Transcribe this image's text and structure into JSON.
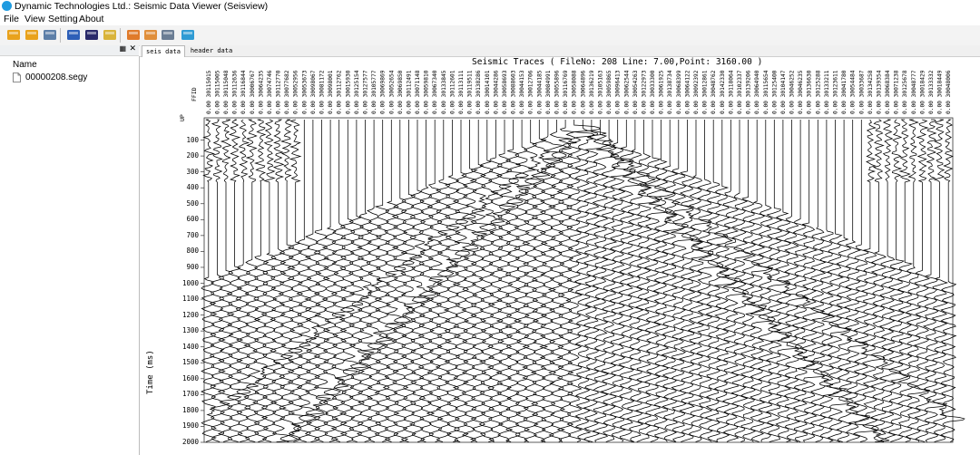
{
  "window": {
    "title": "Dynamic Technologies Ltd.: Seismic Data Viewer (Seisview)"
  },
  "menu": [
    {
      "label": "File",
      "x": 4
    },
    {
      "label": "View",
      "x": 27
    },
    {
      "label": "Setting",
      "x": 53
    },
    {
      "label": "About",
      "x": 87
    }
  ],
  "toolbar": {
    "buttons": [
      {
        "name": "open-folder-icon",
        "color": "#e9a21c",
        "x": 6
      },
      {
        "name": "open-folder-alt-icon",
        "color": "#e9a21c",
        "x": 26
      },
      {
        "name": "pencil-icon",
        "color": "#5d7fa8",
        "x": 46
      },
      {
        "name": "chart-icon",
        "color": "#2d5fb8",
        "x": 72
      },
      {
        "name": "wiggle-icon",
        "color": "#2a2a6a",
        "x": 92
      },
      {
        "name": "save-disk-icon",
        "color": "#d9b43a",
        "x": 112
      },
      {
        "name": "export-icon",
        "color": "#e07a2a",
        "x": 138
      },
      {
        "name": "copy-icon",
        "color": "#e08f3c",
        "x": 157
      },
      {
        "name": "print-icon",
        "color": "#6a7d94",
        "x": 176
      },
      {
        "name": "import-icon",
        "color": "#2f9bd4",
        "x": 198
      }
    ]
  },
  "tree": {
    "column_header": "Name",
    "files": [
      {
        "label": "00000208.segy"
      }
    ]
  },
  "tabs": [
    {
      "label": "seis data",
      "active": true
    },
    {
      "label": "header data",
      "active": false
    }
  ],
  "plot": {
    "title": "Seismic Traces ( FileNo: 208  Line: 7.00,Point: 3160.00 )",
    "ylabel": "Time (ms)",
    "header_field": "FFID",
    "unit_label": "UP"
  },
  "chart_data": {
    "type": "seismic_wiggle",
    "title": "Seismic Traces ( FileNo: 208  Line: 7.00,Point: 3160.00 )",
    "ylabel": "Time (ms)",
    "ylim": [
      0,
      2000
    ],
    "y_ticks": [
      100,
      200,
      300,
      400,
      500,
      600,
      700,
      800,
      900,
      1000,
      1100,
      1200,
      1300,
      1400,
      1500,
      1600,
      1700,
      1800,
      1900,
      2000
    ],
    "trace_headers": [
      "0.00 30115015",
      "0.00 30115005",
      "0.00 30115048",
      "0.00 30112636",
      "0.00 30116844",
      "0.00 30006767",
      "0.00 30064235",
      "0.00 30074746",
      "0.00 30112770",
      "0.00 30077682",
      "0.00 30052956",
      "0.00 30053673",
      "0.00 30098067",
      "0.00 30081172",
      "0.00 30098001",
      "0.00 30112762",
      "0.00 30015930",
      "0.00 30125154",
      "0.00 30127577",
      "0.00 30105777",
      "0.00 30069869",
      "0.00 30052654",
      "0.00 30069850",
      "0.00 30112491",
      "0.00 30071148",
      "0.00 30059810",
      "0.00 30067340",
      "0.00 30133845",
      "0.00 30112601",
      "0.00 30113111",
      "0.00 30119511",
      "0.00 30138286",
      "0.00 30014101",
      "0.00 30044286",
      "0.00 30058693",
      "0.00 30088603",
      "0.00 30044153",
      "0.00 30012706",
      "0.00 30044185",
      "0.00 30084991",
      "0.00 30055896",
      "0.00 30116769",
      "0.00 30058088",
      "0.00 30064896",
      "0.00 30136219",
      "0.00 30105163",
      "0.00 30059865",
      "0.00 30096413",
      "0.00 30062544",
      "0.00 30054263",
      "0.00 30122973",
      "0.00 30033300",
      "0.00 30061925",
      "0.00 30138734",
      "0.00 30068399",
      "0.00 30064122",
      "0.00 30092392",
      "0.00 30012861",
      "0.00 30048762",
      "0.00 30142330",
      "0.00 30118064",
      "0.00 30102337",
      "0.00 30139206",
      "0.00 30064940",
      "0.00 30115654",
      "0.00 30125400",
      "0.00 30104147",
      "0.00 30046252",
      "0.00 30046235",
      "0.00 30136630",
      "0.00 30125288",
      "0.00 30133211",
      "0.00 30123611",
      "0.00 30041780",
      "0.00 30054484",
      "0.00 30033687",
      "0.00 30134258",
      "0.00 30139354",
      "0.00 30068384",
      "0.00 30071238",
      "0.00 30125678",
      "0.00 30048777",
      "0.00 30018429",
      "0.00 30133332",
      "0.00 30018449",
      "0.00 30048006"
    ]
  }
}
